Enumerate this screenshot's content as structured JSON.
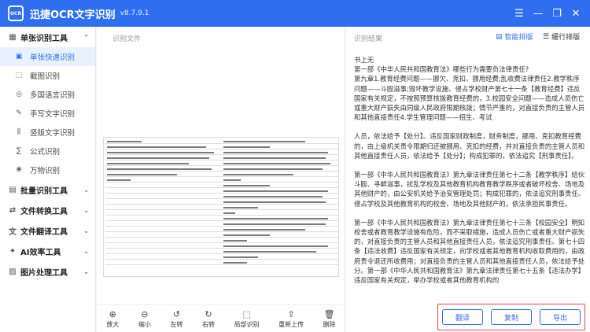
{
  "app": {
    "logo_text": "OCR",
    "title": "迅捷OCR文字识别",
    "version": "v8.7.9.1"
  },
  "window_controls": {
    "menu": "☰",
    "minimize": "—",
    "restore": "❐",
    "close": "✕"
  },
  "sidebar": {
    "groups": [
      {
        "label": "单张识别工具",
        "icon": "grid-icon",
        "glyph": "▦",
        "expanded": true,
        "items": [
          {
            "label": "单张快速识别",
            "icon": "image-icon",
            "glyph": "▣",
            "active": true
          },
          {
            "label": "截图识别",
            "icon": "screenshot-icon",
            "glyph": "⬚",
            "active": false
          },
          {
            "label": "多国语言识别",
            "icon": "globe-icon",
            "glyph": "◎",
            "active": false
          },
          {
            "label": "手写文字识别",
            "icon": "pen-icon",
            "glyph": "✎",
            "active": false
          },
          {
            "label": "竖版文字识别",
            "icon": "vertical-text-icon",
            "glyph": "⫼",
            "active": false
          },
          {
            "label": "公式识别",
            "icon": "formula-icon",
            "glyph": "∑",
            "active": false
          },
          {
            "label": "万物识别",
            "icon": "object-icon",
            "glyph": "❀",
            "active": false
          }
        ]
      },
      {
        "label": "批量识别工具",
        "icon": "batch-icon",
        "glyph": "▤",
        "expanded": false,
        "items": []
      },
      {
        "label": "文件转换工具",
        "icon": "convert-icon",
        "glyph": "⇄",
        "expanded": false,
        "items": []
      },
      {
        "label": "文件翻译工具",
        "icon": "translate-icon",
        "glyph": "文",
        "expanded": false,
        "items": []
      },
      {
        "label": "AI效率工具",
        "icon": "ai-icon",
        "glyph": "✦",
        "expanded": false,
        "items": []
      },
      {
        "label": "图片处理工具",
        "icon": "picture-icon",
        "glyph": "▨",
        "expanded": false,
        "items": []
      }
    ]
  },
  "left_pane": {
    "label": "识别文件",
    "toolbar": [
      {
        "label": "放大",
        "icon": "zoom-in-icon",
        "glyph": "⊕"
      },
      {
        "label": "缩小",
        "icon": "zoom-out-icon",
        "glyph": "⊖"
      },
      {
        "label": "左转",
        "icon": "rotate-left-icon",
        "glyph": "↺"
      },
      {
        "label": "右转",
        "icon": "rotate-right-icon",
        "glyph": "↻"
      },
      {
        "label": "局部识别",
        "icon": "crop-icon",
        "glyph": "⬚"
      },
      {
        "label": "重新上传",
        "icon": "upload-icon",
        "glyph": "⇪"
      },
      {
        "label": "删除",
        "icon": "trash-icon",
        "glyph": "🗑"
      }
    ]
  },
  "right_pane": {
    "label": "识别结果",
    "smart_layout": "智能排版",
    "reflow": "缓行排版",
    "paragraphs": [
      "书上无\n第一部《中华人民共和国教育法》哪些行为需要负法律责任?\n第九章1.教育经费问题——挪欠、克扣、挪用经费;乱收费法律责任2.教学秩序问题——斗殴滋事;毁坏教学设施、侵占学校财产第七十一条【教育经费】违反国家有关规定，不按照预算核拨教育经费的，3.校园安全问题——造成人员伤亡或重大财产损失由同级人民政府限期核拨；情节严重的，对直接负责的主管人员和其他直接责任4.学生管理问题——招生、考试",
      "人员，依法给予【处分】。违反国家财政制度，财务制度，挪用、克扣教育经费的，由上级机关责令限期归还被挪用、克扣的经费，并对直接负责的主管人员和其他直接责任人员，依法给予【处分】；构成犯罪的，依法追究【刑事责任】。",
      "第一部《中华人民共和国教育法》第九章法律责任第七十二条【教学秩序】结伙斗殴、寻衅滋事，扰乱学校及其他教育机构教育教学秩序或者破坏校舍、场地及其他财产的，由公安机关给予治安管理处罚；构成犯罪的，依法追究刑事责任。侵占学校及其他教育机构的校舍、场地及其他财产的，依法承担民事责任。",
      "第一部《中华人民共和国教育法》第九章法律责任第七十三条【校园安全】明知校舍或者教育教学设施有危险，而不采取措施，造成人员伤亡或者重大财产损失的，对直接负责的主管人员和其他直接责任人员，依法追究刑事责任。第七十四条【违法收费】违反国家有关规定，向学校或者其他教育机构收取费用的，由政府责令退还所收费用；对直接负责的主管人员和其他直接责任人员，依法给予处分。第一部《中华人民共和国教育法》第九章法律责任第七十五条【违法办学】违反国家有关规定，举办学校或者其他教育机构的"
    ],
    "actions": {
      "translate": "翻译",
      "copy": "复制",
      "export": "导出"
    }
  }
}
